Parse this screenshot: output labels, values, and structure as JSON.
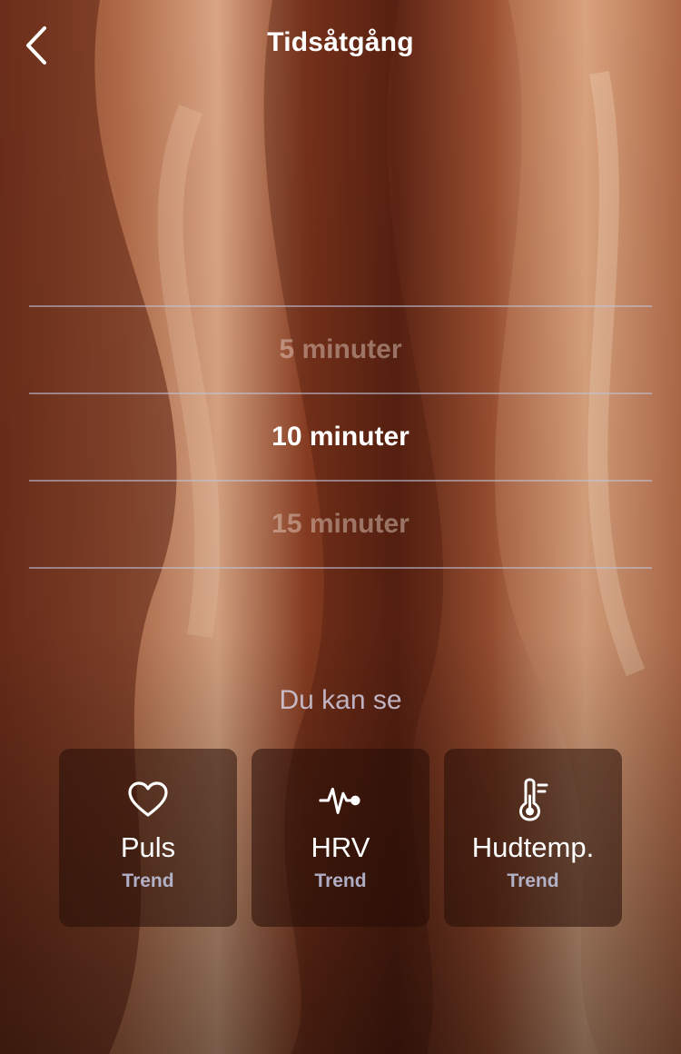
{
  "header": {
    "title": "Tidsåtgång",
    "back_icon": "chevron-left-icon"
  },
  "picker": {
    "options": [
      {
        "label": "5 minuter",
        "selected": false
      },
      {
        "label": "10 minuter",
        "selected": true
      },
      {
        "label": "15 minuter",
        "selected": false
      }
    ]
  },
  "section": {
    "label": "Du kan se"
  },
  "cards": [
    {
      "icon": "heart-icon",
      "title": "Puls",
      "subtitle": "Trend"
    },
    {
      "icon": "hrv-pulse-icon",
      "title": "HRV",
      "subtitle": "Trend"
    },
    {
      "icon": "thermometer-icon",
      "title": "Hudtemp.",
      "subtitle": "Trend"
    }
  ],
  "colors": {
    "background": "#5a2716",
    "divider": "#bec4de",
    "card_background": "#260c06"
  }
}
